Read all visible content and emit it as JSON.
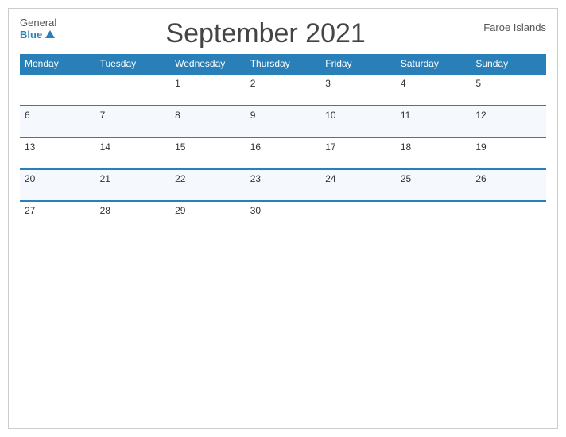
{
  "header": {
    "logo_general": "General",
    "logo_blue": "Blue",
    "title": "September 2021",
    "region": "Faroe Islands"
  },
  "weekdays": [
    "Monday",
    "Tuesday",
    "Wednesday",
    "Thursday",
    "Friday",
    "Saturday",
    "Sunday"
  ],
  "weeks": [
    [
      "",
      "",
      "1",
      "2",
      "3",
      "4",
      "5"
    ],
    [
      "6",
      "7",
      "8",
      "9",
      "10",
      "11",
      "12"
    ],
    [
      "13",
      "14",
      "15",
      "16",
      "17",
      "18",
      "19"
    ],
    [
      "20",
      "21",
      "22",
      "23",
      "24",
      "25",
      "26"
    ],
    [
      "27",
      "28",
      "29",
      "30",
      "",
      "",
      ""
    ]
  ]
}
